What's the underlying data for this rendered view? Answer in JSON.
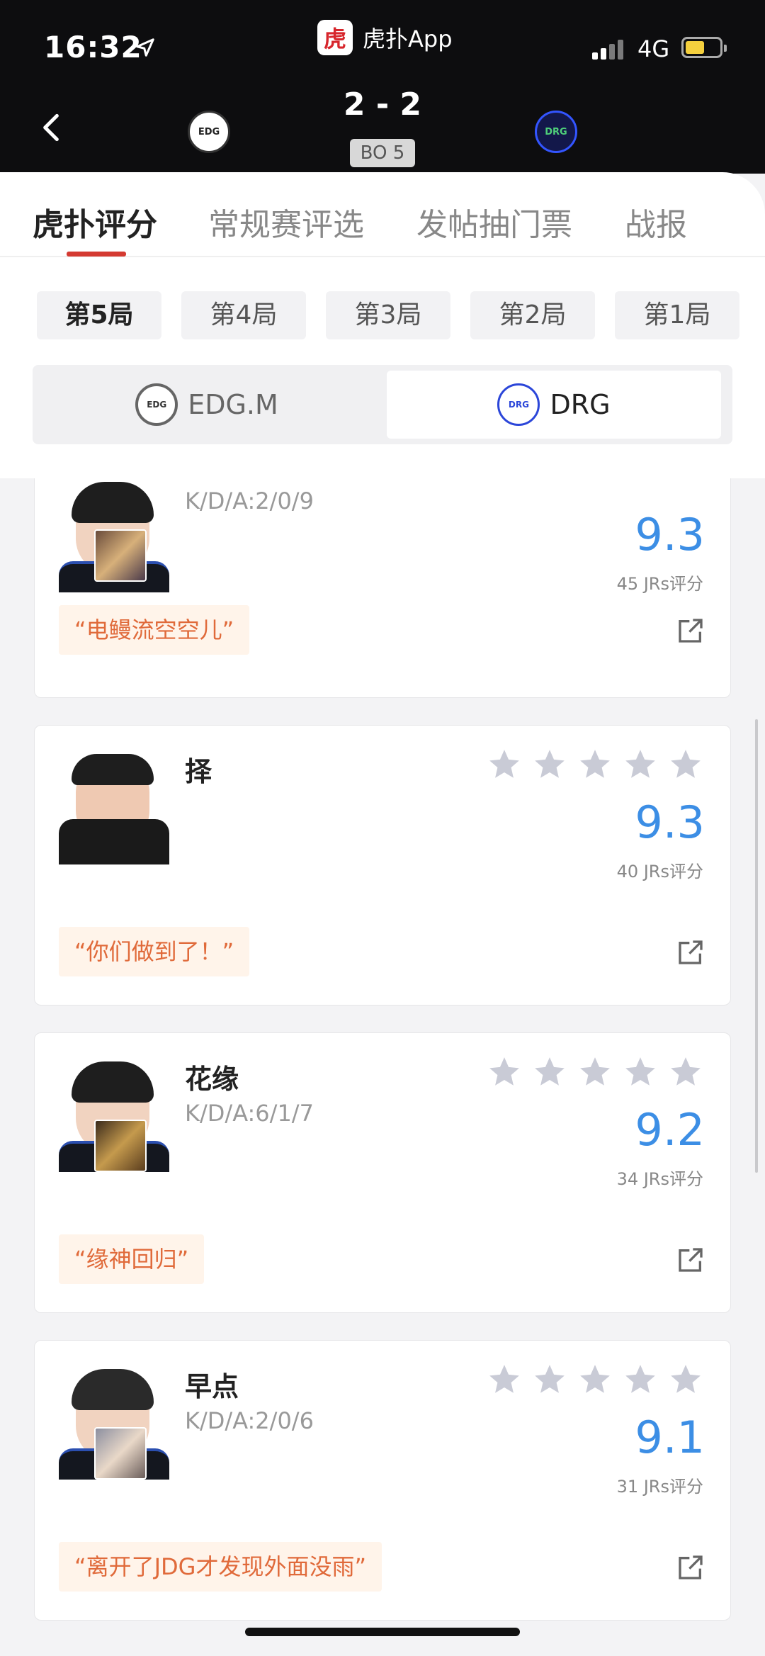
{
  "status_bar": {
    "time": "16:32",
    "network": "4G"
  },
  "app": {
    "logo_char": "虎",
    "name": "虎扑App"
  },
  "match": {
    "score": "2 - 2",
    "format": "BO 5",
    "left_team_logo_text": "EDG",
    "right_team_logo_text": "DRG"
  },
  "tabs": [
    "虎扑评分",
    "常规赛评选",
    "发帖抽门票",
    "战报"
  ],
  "games": [
    "第5局",
    "第4局",
    "第3局",
    "第2局",
    "第1局"
  ],
  "teams": {
    "left": {
      "name": "EDG.M",
      "logo_text": "EDG"
    },
    "right": {
      "name": "DRG",
      "logo_text": "DRG"
    }
  },
  "players": [
    {
      "name": "",
      "kda": "K/D/A:2/0/9",
      "rating": "9.3",
      "votes": "45 JRs评分",
      "quote": "“电鳗流空空儿”",
      "stars": 5
    },
    {
      "name": "择",
      "kda": "",
      "rating": "9.3",
      "votes": "40 JRs评分",
      "quote": "“你们做到了！”",
      "stars": 5
    },
    {
      "name": "花缘",
      "kda": "K/D/A:6/1/7",
      "rating": "9.2",
      "votes": "34 JRs评分",
      "quote": "“缘神回归”",
      "stars": 5
    },
    {
      "name": "早点",
      "kda": "K/D/A:2/0/6",
      "rating": "9.1",
      "votes": "31 JRs评分",
      "quote": "“离开了JDG才发现外面没雨”",
      "stars": 5
    }
  ],
  "colors": {
    "accent_red": "#d43a31",
    "rating_blue": "#3c8ee5",
    "quote_orange": "#e06a3a",
    "star_gray": "#c9cbd6"
  }
}
